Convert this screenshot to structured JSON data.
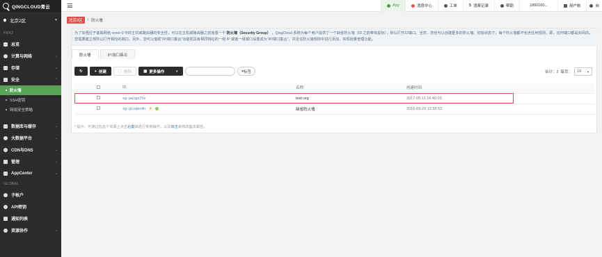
{
  "brand": {
    "name": "QINGCLOUD青云"
  },
  "region": {
    "label": "北京2区"
  },
  "sidebar": {
    "section_zone": "PEK2",
    "items": [
      {
        "label": "总览",
        "icon": "grid-icon"
      },
      {
        "label": "计算与网络",
        "icon": "network-icon"
      },
      {
        "label": "存储",
        "icon": "storage-icon"
      }
    ],
    "security": {
      "label": "安全",
      "icon": "lightning-icon",
      "subs": [
        "防火墙",
        "SSH密钥",
        "网络安全策略"
      ]
    },
    "items2": [
      {
        "label": "数据库与缓存",
        "icon": "database-icon"
      },
      {
        "label": "大数据平台",
        "icon": "bigdata-icon"
      },
      {
        "label": "CDN与DNS",
        "icon": "cdn-icon"
      },
      {
        "label": "管理",
        "icon": "flag-icon"
      },
      {
        "label": "AppCenter",
        "icon": "appcenter-icon"
      }
    ],
    "section_global": "GLOBAL",
    "global_items": [
      {
        "label": "子帐户",
        "icon": "users-icon"
      },
      {
        "label": "API密钥",
        "icon": "key-icon"
      },
      {
        "label": "通知列表",
        "icon": "list-icon"
      },
      {
        "label": "资源协作",
        "icon": "share-icon"
      }
    ]
  },
  "topbar": {
    "app": "App",
    "messages": "消息中心",
    "tickets": "工单",
    "billing": "消费记录",
    "help": "帮助",
    "phone": "1850160...",
    "account": "用户帐",
    "more": "自"
  },
  "breadcrumb": {
    "zone": "北京2区",
    "current": "防火墙"
  },
  "notice": {
    "text_before": "为了加强位于基础网络 vxnet-0 中的主机或路由器的安全性，可以在主机或路由器之前放置一个",
    "term": "防火墙（Security Group）",
    "text_after": "，QingCloud 系统为每个用户提供了一个缺省防火墙（ID 之前带有星标），默认打开22端口。当然，您也可以创建更多的防火墙。初始状态下，每个防火墙都不包含任何规则，即，任何端口都是封闭的，您需要建立规则以打开相应的端口。另外，您可以借助“IP/端口集合”功能把具有相同特征的一组 IP 或者一组端口设置成为“IP/端口集合”，并且在防火墙规则中进行添加，实现批量管理功能。"
  },
  "tabs": [
    "防火墙",
    "IP/端口集合"
  ],
  "toolbar": {
    "create": "创建",
    "delete": "删除",
    "more_actions": "更多操作",
    "search_placeholder": "",
    "tag": "标签"
  },
  "pager": {
    "total": "合计：2",
    "per_page": "每页：",
    "page_size": "10"
  },
  "table": {
    "headers": [
      "ID",
      "名称",
      "创建时间"
    ],
    "rows": [
      {
        "id": "sg-pwlgz7te",
        "name": "test-org",
        "created": "2017-05-11 16:40:03"
      },
      {
        "id": "sg-gisqex4n",
        "name": "缺省防火墙",
        "created": "2016-03-29 12:38:53"
      }
    ]
  },
  "hint": {
    "before": "* 提示：可通过任选个资源上点击",
    "link1": "右键",
    "middle": "来进行常用操作，以及",
    "link2": "双击",
    "after": "来修改基本属性。"
  }
}
